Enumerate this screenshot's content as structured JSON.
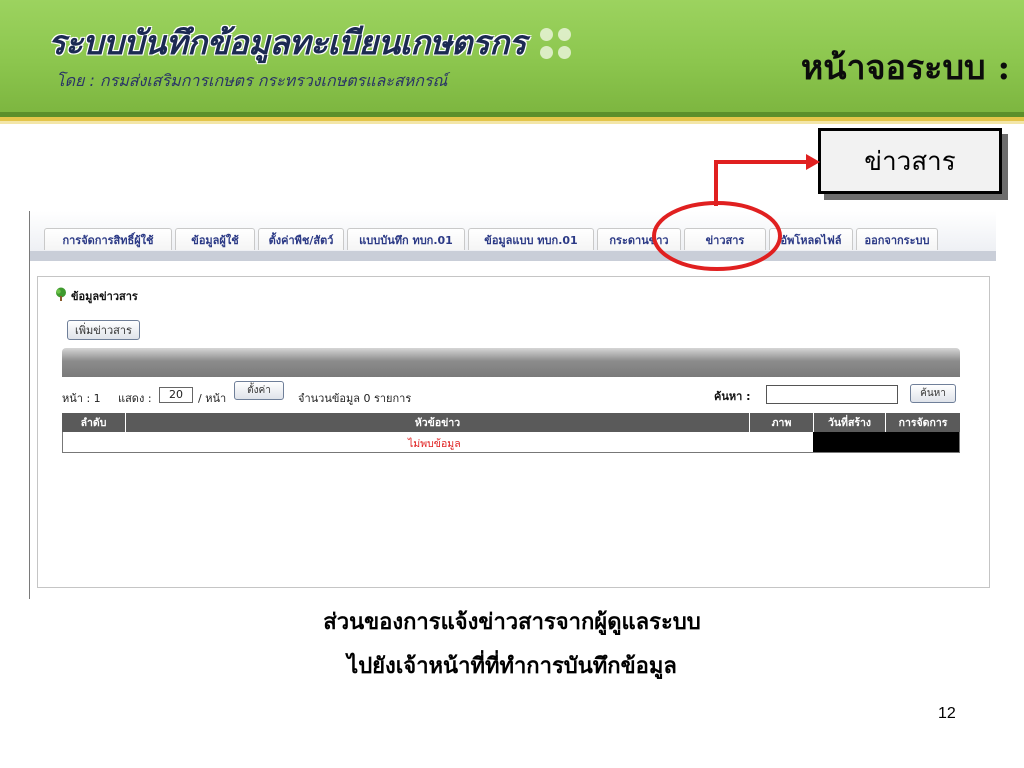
{
  "banner": {
    "title": "ระบบบันทึกข้อมูลทะเบียนเกษตรกร",
    "subtitle": "โดย : กรมส่งเสริมการเกษตร กระทรวงเกษตรและสหกรณ์",
    "right_title": "หน้าจอระบบ :"
  },
  "callout": {
    "label": "ข่าวสาร"
  },
  "app": {
    "tabs": [
      {
        "label": "การจัดการสิทธิ์ผู้ใช้"
      },
      {
        "label": "ข้อมูลผู้ใช้"
      },
      {
        "label": "ตั้งค่าพืช/สัตว์"
      },
      {
        "label": "แบบบันทึก ทบก.01"
      },
      {
        "label": "ข้อมูลแบบ ทบก.01"
      },
      {
        "label": "กระดานข่าว"
      },
      {
        "label": "ข่าวสาร"
      },
      {
        "label": "อัพโหลดไฟล์"
      },
      {
        "label": "ออกจากระบบ"
      }
    ],
    "active_tab": "ข่าวสาร",
    "panel": {
      "title": "ข้อมูลข่าวสาร",
      "add_button": "เพิ่มข่าวสาร",
      "toolbar": {
        "page_label": "หน้า : 1",
        "show_label": "แสดง :",
        "per_page_value": "20",
        "per_page_suffix": "/ หน้า",
        "set_button": "ตั้งค่า",
        "record_count": "จำนวนข้อมูล 0 รายการ",
        "search_label": "ค้นหา :",
        "search_value": "",
        "search_button": "ค้นหา"
      },
      "columns": [
        "ลำดับ",
        "หัวข้อข่าว",
        "ภาพ",
        "วันที่สร้าง",
        "การจัดการ"
      ],
      "empty_message": "ไม่พบข้อมูล"
    }
  },
  "caption": {
    "line1": "ส่วนของการแจ้งข่าวสารจากผู้ดูแลระบบ",
    "line2": "ไปยังเจ้าหน้าที่ที่ทำการบันทึกข้อมูล"
  },
  "page_number": "12",
  "colors": {
    "banner_green": "#8cc64e",
    "tab_text": "#2c3a86",
    "highlight_red": "#e02020",
    "table_header": "#5a5a5a"
  }
}
